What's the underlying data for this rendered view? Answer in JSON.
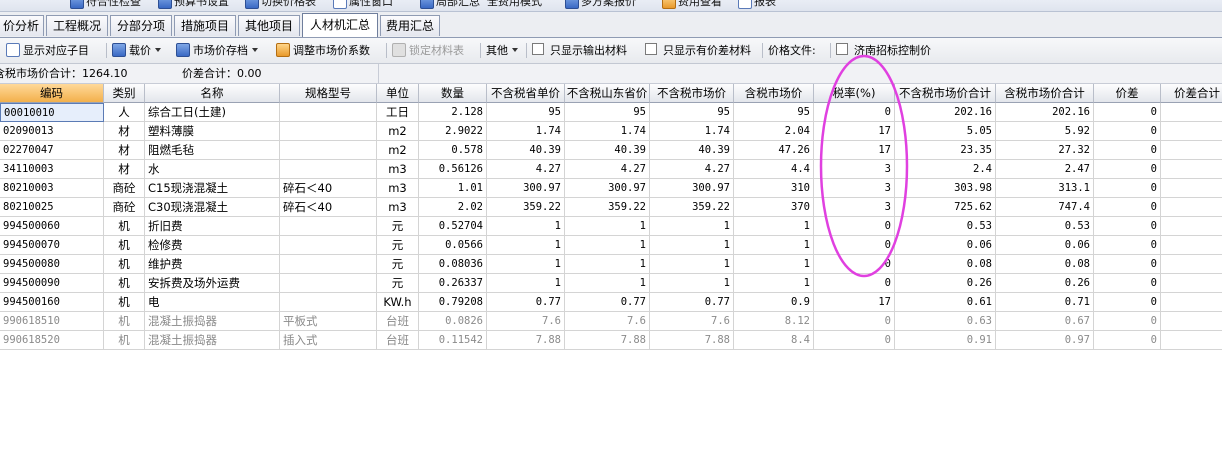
{
  "topbar": {
    "items": [
      "符合性检查",
      "预算书设置",
      "切换价格表",
      "属性窗口",
      "局部汇总",
      "全费用模式",
      "多方案报价",
      "费用查看",
      "报表"
    ]
  },
  "tabs": [
    {
      "label": "价分析"
    },
    {
      "label": "工程概况"
    },
    {
      "label": "分部分项"
    },
    {
      "label": "措施项目"
    },
    {
      "label": "其他项目"
    },
    {
      "label": "人材机汇总",
      "active": true
    },
    {
      "label": "费用汇总"
    }
  ],
  "toolbar": {
    "show_sub": "显示对应子目",
    "load_price": "载价",
    "market_stock": "市场价存档",
    "adjust_coef": "调整市场价系数",
    "lock_qty": "锁定材料表",
    "other": "其他",
    "only_output": "只显示输出材料",
    "only_diff": "只显示有价差材料",
    "price_file_label": "价格文件:",
    "jinan_price": "济南招标控制价"
  },
  "summary": {
    "market_total": "含税市场价合计：1264.10",
    "diff_total": "价差合计：0.00"
  },
  "columns": [
    "编码",
    "类别",
    "名称",
    "规格型号",
    "单位",
    "数量",
    "不含税省单价",
    "不含税山东省价",
    "不含税市场价",
    "含税市场价",
    "税率(%)",
    "不含税市场价合计",
    "含税市场价合计",
    "价差",
    "价差合计"
  ],
  "rows": [
    {
      "code": "00010010",
      "cat": "人",
      "name": "综合工日(土建)",
      "spec": "",
      "unit": "工日",
      "qty": "2.128",
      "p1": "95",
      "p2": "95",
      "p3": "95",
      "p4": "95",
      "tax": "0",
      "t1": "202.16",
      "t2": "202.16",
      "d": "0",
      "dt": "0"
    },
    {
      "code": "02090013",
      "cat": "材",
      "name": "塑料薄膜",
      "spec": "",
      "unit": "m2",
      "qty": "2.9022",
      "p1": "1.74",
      "p2": "1.74",
      "p3": "1.74",
      "p4": "2.04",
      "tax": "17",
      "t1": "5.05",
      "t2": "5.92",
      "d": "0",
      "dt": "0"
    },
    {
      "code": "02270047",
      "cat": "材",
      "name": "阻燃毛毡",
      "spec": "",
      "unit": "m2",
      "qty": "0.578",
      "p1": "40.39",
      "p2": "40.39",
      "p3": "40.39",
      "p4": "47.26",
      "tax": "17",
      "t1": "23.35",
      "t2": "27.32",
      "d": "0",
      "dt": "0"
    },
    {
      "code": "34110003",
      "cat": "材",
      "name": "水",
      "spec": "",
      "unit": "m3",
      "qty": "0.56126",
      "p1": "4.27",
      "p2": "4.27",
      "p3": "4.27",
      "p4": "4.4",
      "tax": "3",
      "t1": "2.4",
      "t2": "2.47",
      "d": "0",
      "dt": "0"
    },
    {
      "code": "80210003",
      "cat": "商砼",
      "name": "C15现浇混凝土",
      "spec": "碎石＜40",
      "unit": "m3",
      "qty": "1.01",
      "p1": "300.97",
      "p2": "300.97",
      "p3": "300.97",
      "p4": "310",
      "tax": "3",
      "t1": "303.98",
      "t2": "313.1",
      "d": "0",
      "dt": "0"
    },
    {
      "code": "80210025",
      "cat": "商砼",
      "name": "C30现浇混凝土",
      "spec": "碎石＜40",
      "unit": "m3",
      "qty": "2.02",
      "p1": "359.22",
      "p2": "359.22",
      "p3": "359.22",
      "p4": "370",
      "tax": "3",
      "t1": "725.62",
      "t2": "747.4",
      "d": "0",
      "dt": "0"
    },
    {
      "code": "994500060",
      "cat": "机",
      "name": "折旧费",
      "spec": "",
      "unit": "元",
      "qty": "0.52704",
      "p1": "1",
      "p2": "1",
      "p3": "1",
      "p4": "1",
      "tax": "0",
      "t1": "0.53",
      "t2": "0.53",
      "d": "0",
      "dt": "0"
    },
    {
      "code": "994500070",
      "cat": "机",
      "name": "检修费",
      "spec": "",
      "unit": "元",
      "qty": "0.0566",
      "p1": "1",
      "p2": "1",
      "p3": "1",
      "p4": "1",
      "tax": "0",
      "t1": "0.06",
      "t2": "0.06",
      "d": "0",
      "dt": "0"
    },
    {
      "code": "994500080",
      "cat": "机",
      "name": "维护费",
      "spec": "",
      "unit": "元",
      "qty": "0.08036",
      "p1": "1",
      "p2": "1",
      "p3": "1",
      "p4": "1",
      "tax": "0",
      "t1": "0.08",
      "t2": "0.08",
      "d": "0",
      "dt": "0"
    },
    {
      "code": "994500090",
      "cat": "机",
      "name": "安拆费及场外运费",
      "spec": "",
      "unit": "元",
      "qty": "0.26337",
      "p1": "1",
      "p2": "1",
      "p3": "1",
      "p4": "1",
      "tax": "0",
      "t1": "0.26",
      "t2": "0.26",
      "d": "0",
      "dt": "0"
    },
    {
      "code": "994500160",
      "cat": "机",
      "name": "电",
      "spec": "",
      "unit": "KW.h",
      "qty": "0.79208",
      "p1": "0.77",
      "p2": "0.77",
      "p3": "0.77",
      "p4": "0.9",
      "tax": "17",
      "t1": "0.61",
      "t2": "0.71",
      "d": "0",
      "dt": "0"
    },
    {
      "code": "990618510",
      "cat": "机",
      "name": "混凝土振捣器",
      "spec": "平板式",
      "unit": "台班",
      "qty": "0.0826",
      "p1": "7.6",
      "p2": "7.6",
      "p3": "7.6",
      "p4": "8.12",
      "tax": "0",
      "t1": "0.63",
      "t2": "0.67",
      "d": "0",
      "dt": "0",
      "grey": true
    },
    {
      "code": "990618520",
      "cat": "机",
      "name": "混凝土振捣器",
      "spec": "插入式",
      "unit": "台班",
      "qty": "0.11542",
      "p1": "7.88",
      "p2": "7.88",
      "p3": "7.88",
      "p4": "8.4",
      "tax": "0",
      "t1": "0.91",
      "t2": "0.97",
      "d": "0",
      "dt": "0",
      "grey": true
    }
  ],
  "colors": {
    "annotation": "#e040e0",
    "header_selected": "#f3b04c",
    "grid_line": "#d4d4d4",
    "grey_text": "#8a8a8a"
  }
}
